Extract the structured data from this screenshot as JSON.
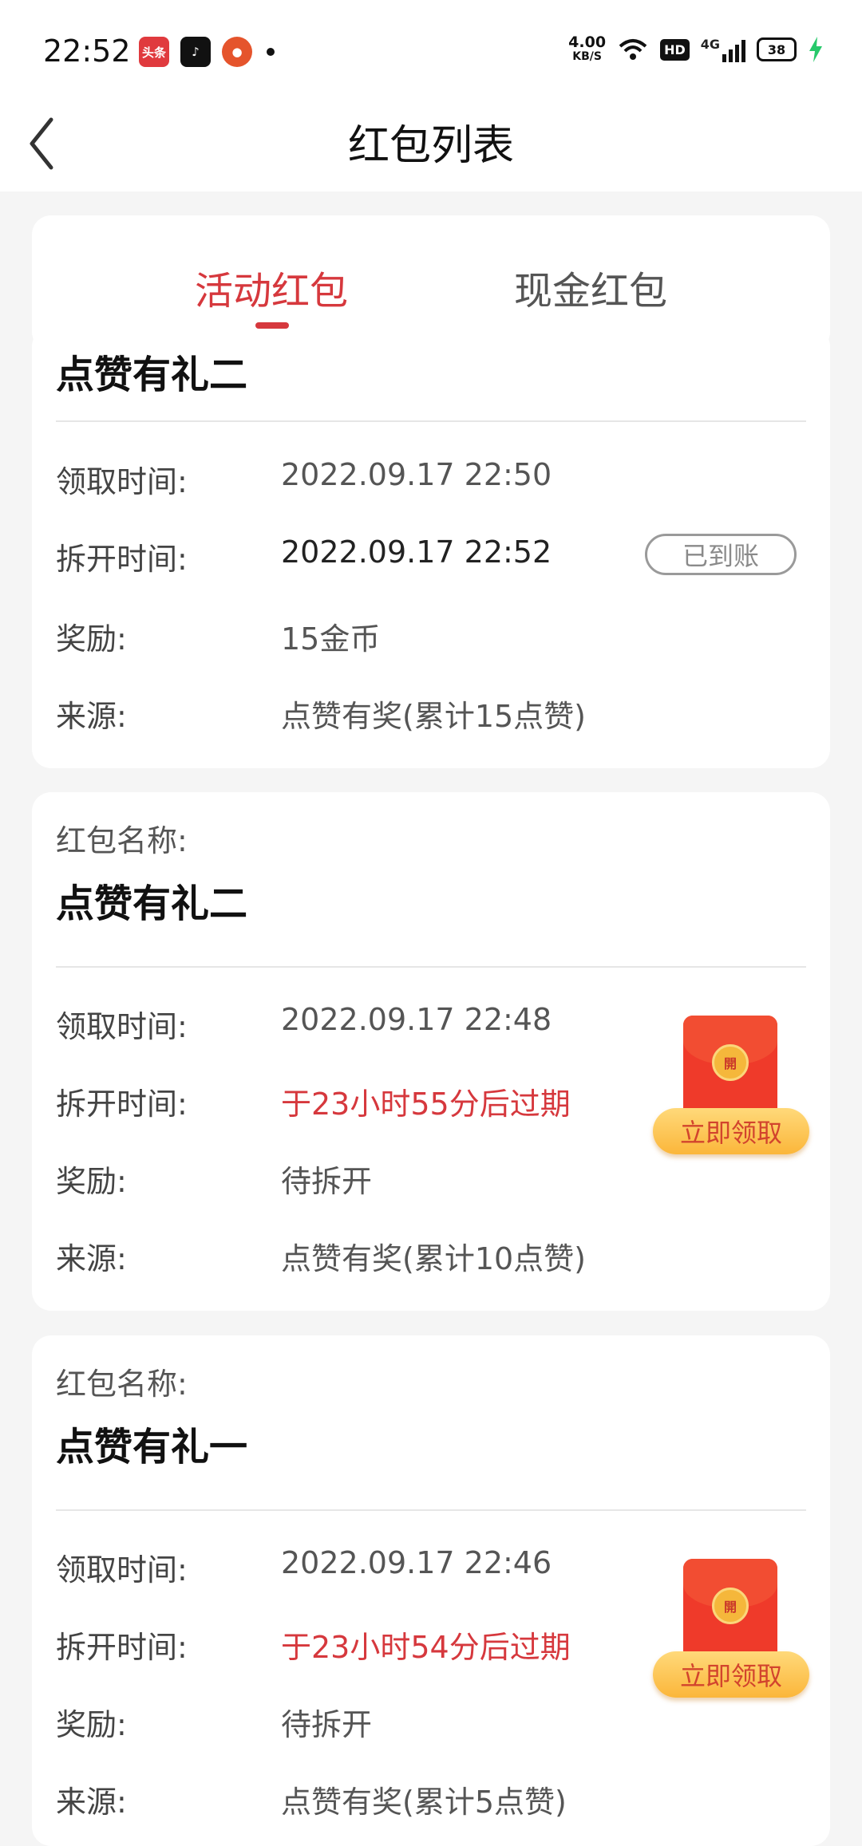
{
  "status_bar": {
    "time": "22:52",
    "notif_apps": [
      {
        "name": "头条",
        "color": "#e03a3e"
      },
      {
        "name": "抖音",
        "color": "#111111"
      },
      {
        "name": "app",
        "color": "#e5542c"
      }
    ],
    "speed_value": "4.00",
    "speed_unit": "KB/S",
    "hd": "HD",
    "network": "4G",
    "battery": "38"
  },
  "header": {
    "title": "红包列表"
  },
  "tabs": [
    {
      "label": "活动红包",
      "active": true
    },
    {
      "label": "现金红包",
      "active": false
    }
  ],
  "labels": {
    "name": "红包名称:",
    "receive_time": "领取时间:",
    "open_time": "拆开时间:",
    "reward": "奖励:",
    "source": "来源:",
    "claim_button": "立即领取",
    "envelope_seal": "開"
  },
  "cards": [
    {
      "name": "点赞有礼二",
      "receive_time": "2022.09.17 22:50",
      "open_time": "2022.09.17 22:52",
      "reward": "15金币",
      "source": "点赞有奖(累计15点赞)",
      "status": "已到账"
    },
    {
      "name": "点赞有礼二",
      "receive_time": "2022.09.17 22:48",
      "open_time": "于23小时55分后过期",
      "reward": "待拆开",
      "source": "点赞有奖(累计10点赞)"
    },
    {
      "name": "点赞有礼一",
      "receive_time": "2022.09.17 22:46",
      "open_time": "于23小时54分后过期",
      "reward": "待拆开",
      "source": "点赞有奖(累计5点赞)"
    }
  ]
}
